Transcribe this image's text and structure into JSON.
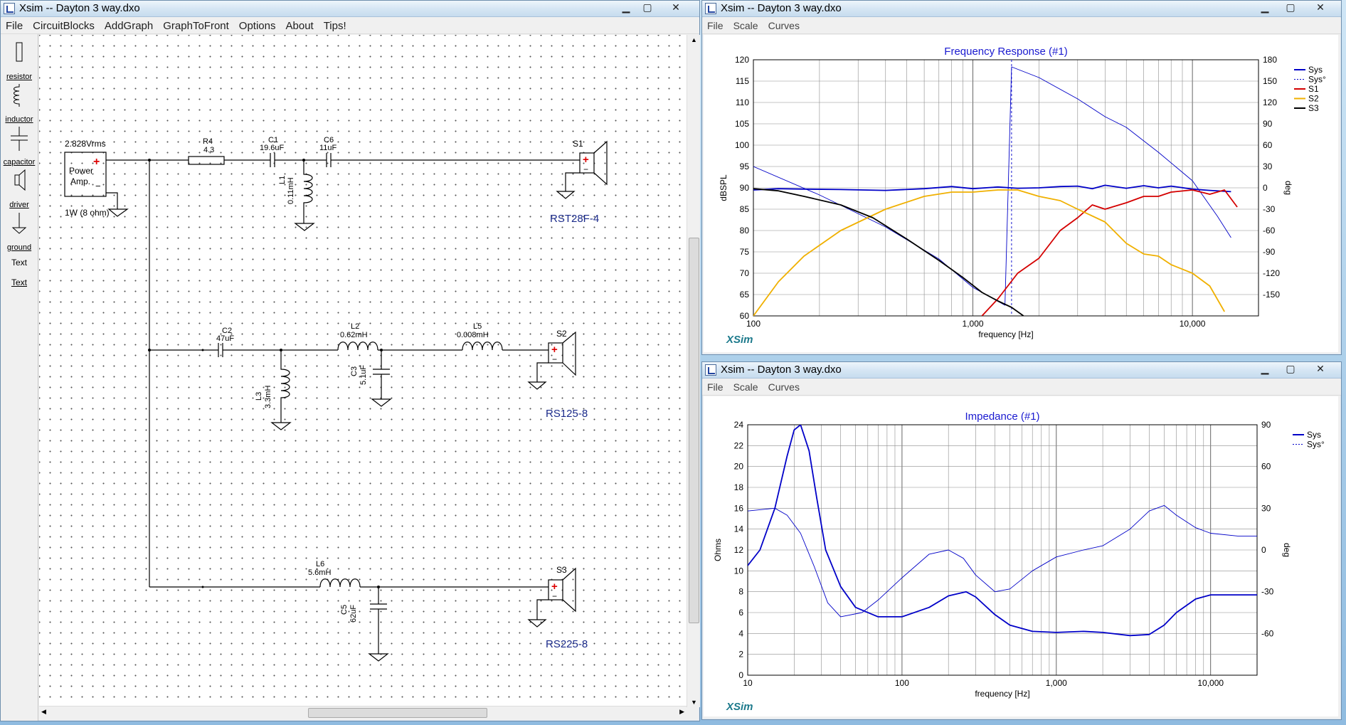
{
  "main_window": {
    "title": "Xsim -- Dayton 3 way.dxo",
    "menu": [
      "File",
      "CircuitBlocks",
      "AddGraph",
      "GraphToFront",
      "Options",
      "About",
      "Tips!"
    ],
    "tools": [
      "resistor",
      "inductor",
      "capacitor",
      "driver",
      "ground",
      "Text",
      "Text"
    ]
  },
  "circuit": {
    "source": {
      "voltage": "2.828Vrms",
      "name1": "Power",
      "name2": "Amp.",
      "plus": "+",
      "minus": "−",
      "load": "1W (8 ohm)"
    },
    "components": {
      "R4": {
        "name": "R4",
        "value": "4.3"
      },
      "C1": {
        "name": "C1",
        "value": "19.6uF"
      },
      "C6": {
        "name": "C6",
        "value": "11uF"
      },
      "L1": {
        "name": "L1",
        "value": "0.11mH"
      },
      "C2": {
        "name": "C2",
        "value": "47uF"
      },
      "L2": {
        "name": "L2",
        "value": "0.62mH"
      },
      "L5": {
        "name": "L5",
        "value": "0.008mH"
      },
      "C3": {
        "name": "C3",
        "value": "5.1uF"
      },
      "L3": {
        "name": "L3",
        "value": "3.3mH"
      },
      "L6": {
        "name": "L6",
        "value": "5.6mH"
      },
      "C5": {
        "name": "C5",
        "value": "62uF"
      }
    },
    "drivers": [
      {
        "id": "S1",
        "model": "RST28F-4"
      },
      {
        "id": "S2",
        "model": "RS125-8"
      },
      {
        "id": "S3",
        "model": "RS225-8"
      }
    ],
    "plus": "+",
    "minus": "−"
  },
  "freq_window": {
    "title": "Xsim -- Dayton 3 way.dxo",
    "menu": [
      "File",
      "Scale",
      "Curves"
    ],
    "brand": "XSim"
  },
  "imp_window": {
    "title": "Xsim -- Dayton 3 way.dxo",
    "menu": [
      "File",
      "Scale",
      "Curves"
    ],
    "brand": "XSim"
  },
  "chart_data": [
    {
      "type": "line",
      "title": "Frequency Response (#1)",
      "xlabel": "frequency [Hz]",
      "ylabel": "dBSPL",
      "y2label": "deg",
      "xscale": "log",
      "xlim": [
        100,
        20000
      ],
      "ylim": [
        60,
        120
      ],
      "y2lim": [
        -180,
        180
      ],
      "xticks": [
        "100",
        "1,000",
        "10,000"
      ],
      "yticks": [
        "120",
        "115",
        "110",
        "105",
        "100",
        "95",
        "90",
        "85",
        "80",
        "75",
        "70",
        "65",
        "60"
      ],
      "y2ticks": [
        "180",
        "150",
        "120",
        "90",
        "60",
        "30",
        "0",
        "-30",
        "-60",
        "-90",
        "-120",
        "-150"
      ],
      "grid": true,
      "legend_position": "right",
      "marker_x": 1500,
      "series": [
        {
          "name": "Sys",
          "color": "#0000c8",
          "axis": "left",
          "x": [
            100,
            130,
            170,
            250,
            400,
            600,
            800,
            1000,
            1300,
            1600,
            2000,
            2500,
            3000,
            3500,
            4000,
            5000,
            6000,
            7000,
            8000,
            10000,
            12000,
            15000
          ],
          "y": [
            89.5,
            89.8,
            89.7,
            89.6,
            89.4,
            89.8,
            90.3,
            89.8,
            90.2,
            89.9,
            90.0,
            90.3,
            90.4,
            89.8,
            90.6,
            89.9,
            90.5,
            90.0,
            90.4,
            89.7,
            89.4,
            89.1
          ]
        },
        {
          "name": "Sys°",
          "color": "#0000c8",
          "axis": "right",
          "dashed": true,
          "x": [
            100,
            200,
            400,
            700,
            1000,
            1400,
            1500,
            2000,
            3000,
            4000,
            5000,
            7000,
            10000,
            13000,
            15000
          ],
          "y": [
            30,
            -10,
            -55,
            -100,
            -140,
            -165,
            170,
            155,
            125,
            100,
            85,
            50,
            10,
            -40,
            -70
          ]
        },
        {
          "name": "S1",
          "color": "#d40000",
          "axis": "left",
          "x": [
            1100,
            1300,
            1600,
            2000,
            2500,
            3000,
            3500,
            4000,
            5000,
            6000,
            7000,
            8000,
            10000,
            12000,
            14000,
            16000
          ],
          "y": [
            60,
            64,
            70,
            73.5,
            80,
            83,
            86,
            85,
            86.5,
            88,
            88,
            89,
            89.5,
            88.5,
            89.5,
            85.5
          ]
        },
        {
          "name": "S2",
          "color": "#f0b000",
          "axis": "left",
          "x": [
            100,
            130,
            170,
            250,
            400,
            600,
            800,
            1000,
            1300,
            1600,
            2000,
            2500,
            3000,
            4000,
            5000,
            6000,
            7000,
            8000,
            10000,
            12000,
            14000
          ],
          "y": [
            60,
            68,
            74,
            80,
            85,
            88,
            89,
            89,
            89.5,
            89.5,
            88,
            87,
            85,
            82,
            77,
            74.5,
            74,
            72,
            70,
            67,
            61
          ]
        },
        {
          "name": "S3",
          "color": "#000000",
          "axis": "left",
          "x": [
            100,
            130,
            170,
            250,
            350,
            500,
            700,
            900,
            1100,
            1300,
            1500,
            1700
          ],
          "y": [
            89.8,
            89.3,
            88,
            86,
            83,
            78,
            73,
            69,
            65.5,
            63.5,
            62,
            60
          ]
        }
      ]
    },
    {
      "type": "line",
      "title": "Impedance (#1)",
      "xlabel": "frequency [Hz]",
      "ylabel": "Ohms",
      "y2label": "deg",
      "xscale": "log",
      "xlim": [
        10,
        20000
      ],
      "ylim": [
        0,
        24
      ],
      "y2lim": [
        -90,
        90
      ],
      "xticks": [
        "10",
        "100",
        "1,000",
        "10,000"
      ],
      "yticks": [
        "24",
        "22",
        "20",
        "18",
        "16",
        "14",
        "12",
        "10",
        "8",
        "6",
        "4",
        "2",
        "0"
      ],
      "y2ticks": [
        "90",
        "60",
        "30",
        "0",
        "-30",
        "-60"
      ],
      "grid": true,
      "legend_position": "right",
      "series": [
        {
          "name": "Sys",
          "color": "#0000c8",
          "axis": "left",
          "x": [
            10,
            12,
            15,
            18,
            20,
            22,
            25,
            28,
            32,
            40,
            50,
            70,
            100,
            150,
            200,
            260,
            300,
            400,
            500,
            700,
            1000,
            1500,
            2000,
            3000,
            4000,
            5000,
            6000,
            8000,
            10000,
            15000,
            20000
          ],
          "y": [
            10.5,
            12,
            16,
            21,
            23.5,
            24,
            21.5,
            17,
            12,
            8.5,
            6.5,
            5.6,
            5.6,
            6.5,
            7.6,
            8,
            7.5,
            5.8,
            4.8,
            4.2,
            4.1,
            4.2,
            4.1,
            3.8,
            3.9,
            4.8,
            6,
            7.3,
            7.7,
            7.7,
            7.7
          ]
        },
        {
          "name": "Sys°",
          "color": "#0000c8",
          "axis": "right",
          "dashed": true,
          "x": [
            10,
            15,
            18,
            22,
            27,
            33,
            40,
            55,
            70,
            100,
            150,
            200,
            250,
            300,
            400,
            500,
            700,
            1000,
            1500,
            2000,
            3000,
            4000,
            5000,
            6000,
            8000,
            10000,
            15000,
            20000
          ],
          "y": [
            28,
            30,
            25,
            12,
            -12,
            -38,
            -48,
            -45,
            -36,
            -20,
            -3,
            0,
            -6,
            -18,
            -30,
            -28,
            -15,
            -5,
            0,
            3,
            15,
            28,
            32,
            25,
            16,
            12,
            10,
            10
          ]
        }
      ]
    }
  ]
}
